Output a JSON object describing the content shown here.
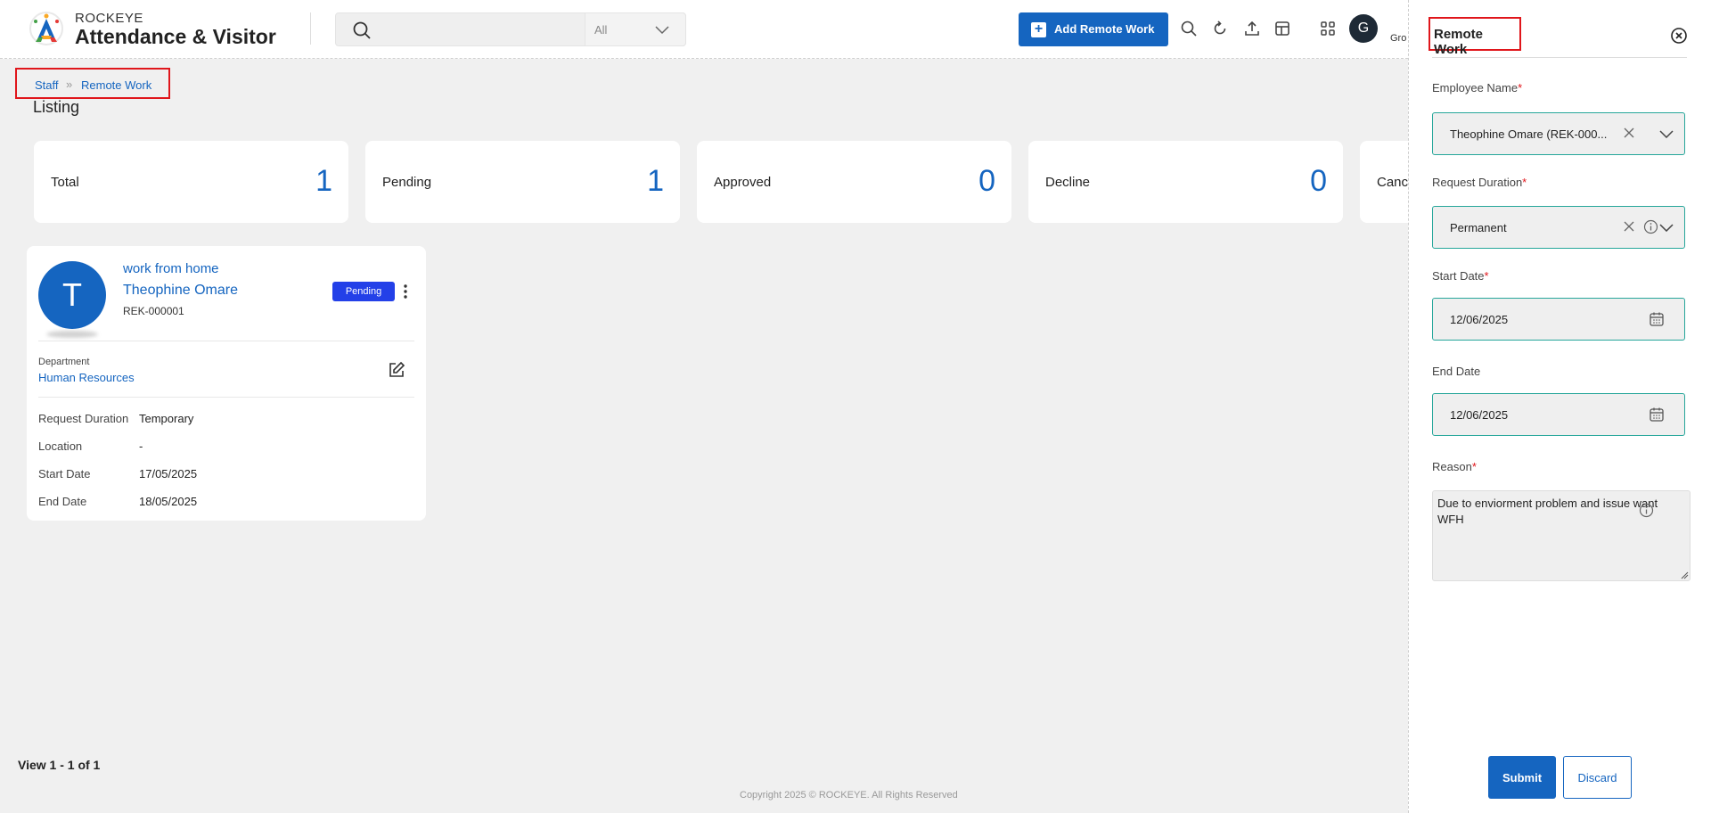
{
  "header": {
    "brand_top": "ROCKEYE",
    "brand_title": "Attendance & Visitor",
    "search_placeholder": "",
    "search_filter": "All",
    "add_button_label": "Add Remote Work",
    "user_initial": "G",
    "user_name_partial": "Gro"
  },
  "breadcrumb": {
    "items": [
      "Staff",
      "Remote Work"
    ],
    "separator": "»"
  },
  "page_title": "Listing",
  "stats": [
    {
      "label": "Total",
      "value": "1"
    },
    {
      "label": "Pending",
      "value": "1"
    },
    {
      "label": "Approved",
      "value": "0"
    },
    {
      "label": "Decline",
      "value": "0"
    },
    {
      "label": "Canc",
      "value": ""
    }
  ],
  "card": {
    "initial": "T",
    "type": "work from home",
    "name": "Theophine Omare",
    "id": "REK-000001",
    "status": "Pending",
    "department_label": "Department",
    "department_value": "Human Resources",
    "rows": [
      {
        "label": "Request Duration",
        "value": "Temporary"
      },
      {
        "label": "Location",
        "value": "-"
      },
      {
        "label": "Start Date",
        "value": "17/05/2025"
      },
      {
        "label": "End Date",
        "value": "18/05/2025"
      }
    ]
  },
  "view_count": "View 1 - 1 of 1",
  "copyright": "Copyright 2025 © ROCKEYE. All Rights Reserved",
  "panel": {
    "title": "Remote Work",
    "employee_label": "Employee Name",
    "employee_value": "Theophine Omare (REK-000...",
    "duration_label": "Request Duration",
    "duration_value": "Permanent",
    "start_label": "Start Date",
    "start_value": "12/06/2025",
    "end_label": "End Date",
    "end_value": "12/06/2025",
    "reason_label": "Reason",
    "reason_value": "Due to enviorment problem and issue want WFH",
    "required_mark": "*",
    "submit_label": "Submit",
    "discard_label": "Discard"
  },
  "colors": {
    "primary": "#1565c0",
    "badge": "#2340e8",
    "field_border": "#26a69a",
    "highlight": "#e0161b"
  }
}
